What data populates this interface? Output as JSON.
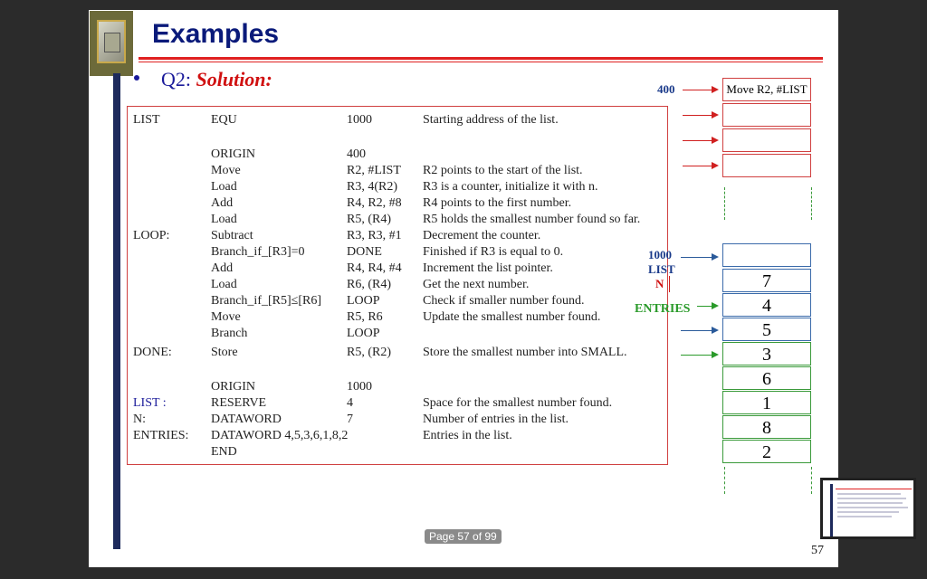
{
  "slide": {
    "title": "Examples",
    "subtitle_prefix": "Q2: ",
    "subtitle_solution": "Solution",
    "subtitle_colon": ":"
  },
  "code_lines": [
    {
      "label": "LIST",
      "op": "EQU",
      "arg": "1000",
      "comment": "Starting address of the list."
    },
    {
      "label": "",
      "op": "ORIGIN",
      "arg": "400",
      "comment": ""
    },
    {
      "label": "",
      "op": "Move",
      "arg": "R2, #LIST",
      "comment": "R2 points to the start of the list."
    },
    {
      "label": "",
      "op": "Load",
      "arg": "R3, 4(R2)",
      "comment": "R3 is a counter, initialize it with n."
    },
    {
      "label": "",
      "op": "Add",
      "arg": "R4, R2, #8",
      "comment": "R4 points to the first number."
    },
    {
      "label": "",
      "op": "Load",
      "arg": "R5, (R4)",
      "comment": "R5 holds the smallest number found so far."
    },
    {
      "label": "LOOP:",
      "op": "Subtract",
      "arg": "R3, R3, #1",
      "comment": "Decrement the counter."
    },
    {
      "label": "",
      "op": "Branch_if_[R3]=0",
      "arg": "DONE",
      "comment": "Finished if R3 is equal to 0."
    },
    {
      "label": "",
      "op": "Add",
      "arg": "R4, R4, #4",
      "comment": "Increment the list pointer."
    },
    {
      "label": "",
      "op": "Load",
      "arg": "R6, (R4)",
      "comment": "Get the next number."
    },
    {
      "label": "",
      "op": "Branch_if_[R5]≤[R6]",
      "arg": "LOOP",
      "comment": "Check if smaller number found."
    },
    {
      "label": "",
      "op": "Move",
      "arg": "R5, R6",
      "comment": "Update the smallest number found."
    },
    {
      "label": "",
      "op": "Branch",
      "arg": "LOOP",
      "comment": ""
    },
    {
      "label": "DONE:",
      "op": "Store",
      "arg": "R5, (R2)",
      "comment": "Store the smallest number into SMALL."
    },
    {
      "label": "",
      "op": "ORIGIN",
      "arg": "1000",
      "comment": ""
    },
    {
      "label": "LIST    :",
      "op": "RESERVE",
      "arg": "4",
      "comment": "Space for the smallest number found."
    },
    {
      "label": "N:",
      "op": "DATAWORD",
      "arg": "7",
      "comment": "Number of entries in the list."
    },
    {
      "label": "ENTRIES:",
      "op": "DATAWORD  4,5,3,6,1,8,2",
      "arg": "",
      "comment": "Entries in the list."
    },
    {
      "label": "",
      "op": "END",
      "arg": "",
      "comment": ""
    }
  ],
  "memory": {
    "addr_400": "400",
    "first_cell": "Move R2, #LIST",
    "addr_1000": "1000",
    "list_label": "LIST",
    "n_label": "N",
    "entries_label": "ENTRIES",
    "values": [
      "7",
      "4",
      "5",
      "3",
      "6",
      "1",
      "8",
      "2"
    ]
  },
  "footer": {
    "page_badge": "Page 57 of 99",
    "slide_number": "57"
  },
  "colors": {
    "title": "#0a1a7a",
    "accent_red": "#e02020",
    "arrow_blue": "#2a5a9a",
    "entries_green": "#2a9a2a",
    "border_dark": "#1d2a5c"
  }
}
